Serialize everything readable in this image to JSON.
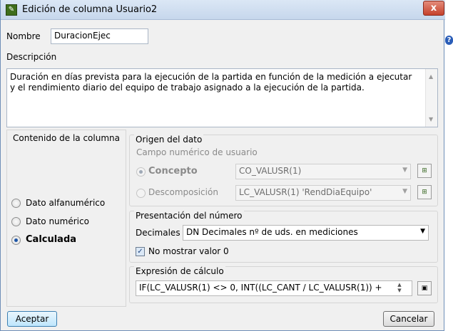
{
  "window": {
    "title": "Edición de columna Usuario2",
    "close_label": "x"
  },
  "help_icon_glyph": "?",
  "name": {
    "label": "Nombre",
    "value": "DuracionEjec"
  },
  "description": {
    "label": "Descripción",
    "value": "Duración en días prevista para la ejecución de la partida en función de la medición a ejecutar y el rendimiento diario del equipo de trabajo asignado a la ejecución de la partida."
  },
  "column_content": {
    "title": "Contenido de la columna",
    "options": [
      {
        "label": "Dato alfanumérico",
        "checked": false
      },
      {
        "label": "Dato numérico",
        "checked": false
      },
      {
        "label": "Calculada",
        "checked": true
      }
    ]
  },
  "data_origin": {
    "title": "Origen del dato",
    "subtitle": "Campo numérico de usuario",
    "concepto_label": "Concepto",
    "concepto_value": "CO_VALUSR(1)",
    "descomposicion_label": "Descomposición",
    "descomposicion_value": "LC_VALUSR(1) 'RendDiaEquipo'"
  },
  "number_presentation": {
    "title": "Presentación del número",
    "decimals_label": "Decimales",
    "decimals_value": "DN Decimales nº de uds. en mediciones",
    "hide_zero_label": "No mostrar valor 0",
    "hide_zero_checked": true
  },
  "calc_expression": {
    "title": "Expresión de cálculo",
    "value": "IF(LC_VALUSR(1) <> 0, INT((LC_CANT / LC_VALUSR(1)) +"
  },
  "buttons": {
    "accept": "Aceptar",
    "cancel": "Cancelar"
  },
  "colors": {
    "title_bar": "#c6d7ec",
    "close_button": "#c5412b",
    "dialog_bg": "#f0f0f0",
    "radio_dot": "#1d55a6"
  }
}
